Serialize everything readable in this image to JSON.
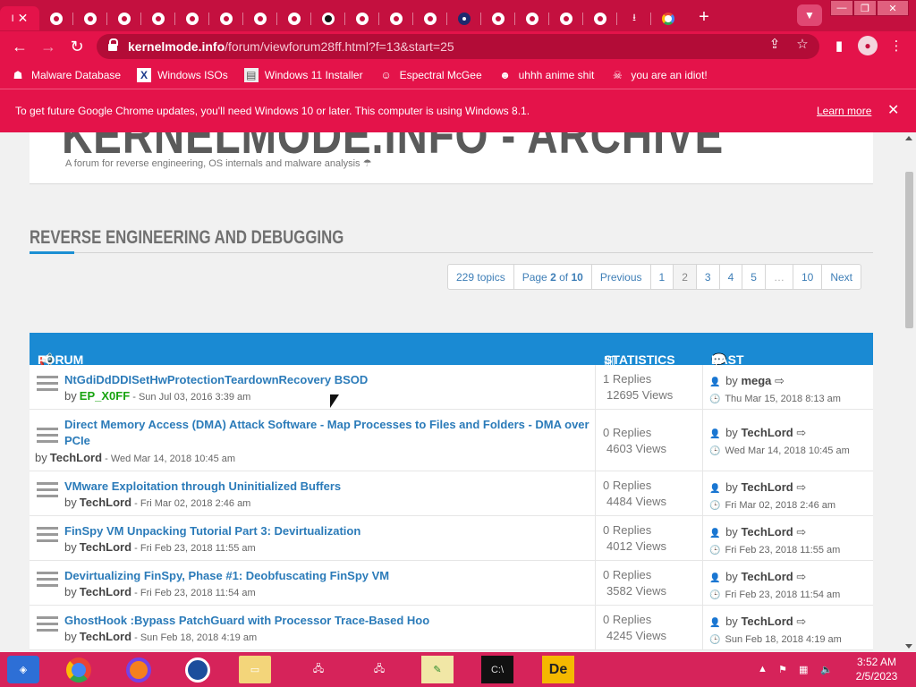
{
  "tabs": {
    "active_label": "I",
    "count_icons": 19
  },
  "toolbar": {
    "url_host": "kernelmode.info",
    "url_path": "/forum/viewforum28ff.html?f=13&start=25"
  },
  "bookmarks": [
    {
      "label": "Malware Database",
      "icon": "malware-icon"
    },
    {
      "label": "Windows ISOs",
      "icon": "x-icon"
    },
    {
      "label": "Windows 11 Installer",
      "icon": "installer-icon"
    },
    {
      "label": "Espectral McGee",
      "icon": "character-icon"
    },
    {
      "label": "uhhh anime shit",
      "icon": "anime-icon"
    },
    {
      "label": "you are an idiot!",
      "icon": "idiot-icon"
    }
  ],
  "infobar": {
    "message": "To get future Google Chrome updates, you'll need Windows 10 or later. This computer is using Windows 8.1.",
    "learn_more": "Learn more"
  },
  "site": {
    "name": "KERNELMODE.INFO - ARCHIVE",
    "description": "A forum for reverse engineering, OS internals and malware analysis"
  },
  "section": {
    "title": "REVERSE ENGINEERING AND DEBUGGING"
  },
  "pagination": {
    "topics": "229 topics",
    "page_prefix": "Page",
    "page_current": "2",
    "page_of": "of",
    "page_total": "10",
    "previous": "Previous",
    "pages": [
      "1",
      "2",
      "3",
      "4",
      "5",
      "…",
      "10"
    ],
    "next": "Next"
  },
  "forum_header": {
    "forum": "FORUM",
    "statistics": "STATISTICS",
    "last_post": "LAST POST"
  },
  "topics": [
    {
      "title": "NtGdiDdDDISetHwProtectionTeardownRecovery BSOD",
      "by": "by",
      "author": "EP_X0FF",
      "date": "- Sun Jul 03, 2016 3:39 am",
      "replies": "1 Replies",
      "views": "12695 Views",
      "last_by": "by",
      "last_author": "mega",
      "last_date": "Thu Mar 15, 2018 8:13 am"
    },
    {
      "title": "Direct Memory Access (DMA) Attack Software - Map Processes to Files and Folders - DMA over PCIe",
      "by": "by",
      "author": "TechLord",
      "date": "- Wed Mar 14, 2018 10:45 am",
      "replies": "0 Replies",
      "views": "4603 Views",
      "last_by": "by",
      "last_author": "TechLord",
      "last_date": "Wed Mar 14, 2018 10:45 am"
    },
    {
      "title": "VMware Exploitation through Uninitialized Buffers",
      "by": "by",
      "author": "TechLord",
      "date": "- Fri Mar 02, 2018 2:46 am",
      "replies": "0 Replies",
      "views": "4484 Views",
      "last_by": "by",
      "last_author": "TechLord",
      "last_date": "Fri Mar 02, 2018 2:46 am"
    },
    {
      "title": "FinSpy VM Unpacking Tutorial Part 3: Devirtualization",
      "by": "by",
      "author": "TechLord",
      "date": "- Fri Feb 23, 2018 11:55 am",
      "replies": "0 Replies",
      "views": "4012 Views",
      "last_by": "by",
      "last_author": "TechLord",
      "last_date": "Fri Feb 23, 2018 11:55 am"
    },
    {
      "title": "Devirtualizing FinSpy, Phase #1: Deobfuscating FinSpy VM",
      "by": "by",
      "author": "TechLord",
      "date": "- Fri Feb 23, 2018 11:54 am",
      "replies": "0 Replies",
      "views": "3582 Views",
      "last_by": "by",
      "last_author": "TechLord",
      "last_date": "Fri Feb 23, 2018 11:54 am"
    },
    {
      "title": "GhostHook :Bypass PatchGuard with Processor Trace-Based Hoo",
      "by": "by",
      "author": "TechLord",
      "date": "- Sun Feb 18, 2018 4:19 am",
      "replies": "0 Replies",
      "views": "4245 Views",
      "last_by": "by",
      "last_author": "TechLord",
      "last_date": "Sun Feb 18, 2018 4:19 am"
    }
  ],
  "taskbar": {
    "time": "3:52 AM",
    "date": "2/5/2023"
  },
  "colors": {
    "theme_dark": "#c4103f",
    "theme": "#e4134a",
    "forum_header": "#1a8ad3",
    "link": "#2b7bb9",
    "author_green": "#17a30f"
  }
}
